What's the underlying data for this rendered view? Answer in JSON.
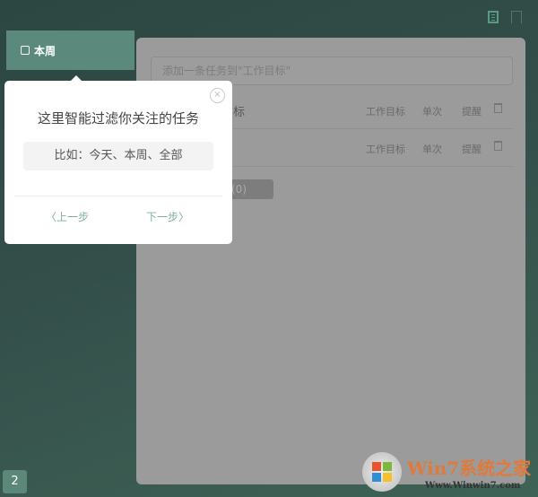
{
  "sidebar": {
    "active_item": "本周"
  },
  "panel": {
    "add_placeholder": "添加一条任务到\"工作目标\"",
    "tasks": [
      {
        "title": "标",
        "list": "工作目标",
        "repeat": "单次",
        "remind": "提醒"
      },
      {
        "title": "",
        "list": "工作目标",
        "repeat": "单次",
        "remind": "提醒"
      }
    ],
    "completed_label": "(0)"
  },
  "popover": {
    "title": "这里智能过滤你关注的任务",
    "example": "比如：今天、本周、全部",
    "prev": "上一步",
    "next": "下一步",
    "close": "×"
  },
  "badge": "2",
  "watermark": {
    "brand": "Win7系统之家",
    "url": "Www.Winwin7.com"
  }
}
